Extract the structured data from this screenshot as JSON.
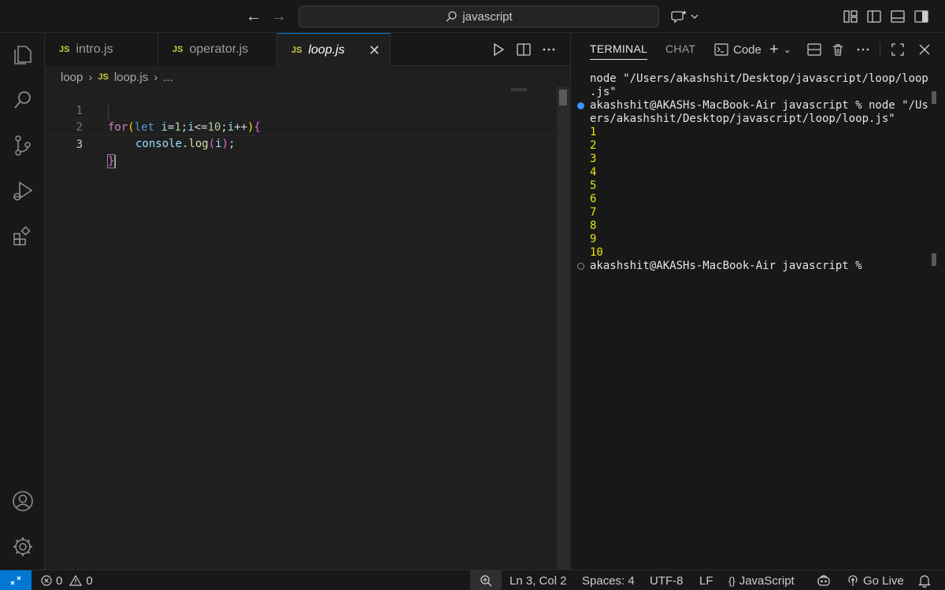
{
  "titlebar": {
    "search_text": "javascript"
  },
  "tabs": [
    {
      "label": "intro.js",
      "badge": "JS"
    },
    {
      "label": "operator.js",
      "badge": "JS"
    },
    {
      "label": "loop.js",
      "badge": "JS"
    }
  ],
  "breadcrumb": {
    "folder": "loop",
    "file": "loop.js",
    "more": "..."
  },
  "editor": {
    "line_numbers": [
      "1",
      "2",
      "3"
    ],
    "code": {
      "line1": {
        "kw_for": "for",
        "open_paren": "(",
        "kw_let": "let",
        "var1": "i",
        "eq": "=",
        "num1": "1",
        "semi1": ";",
        "var2": "i",
        "le": "<=",
        "num2": "10",
        "semi2": ";",
        "var3": "i",
        "inc": "++",
        "close_paren": ")",
        "open_brace": "{"
      },
      "line2": {
        "obj": "console",
        "dot": ".",
        "fn": "log",
        "open": "(",
        "arg": "i",
        "close": ")",
        "semi": ";"
      },
      "line3": {
        "close_brace": "}"
      }
    }
  },
  "panel": {
    "tabs": [
      "TERMINAL",
      "CHAT"
    ],
    "terminal_profile": "Code",
    "lines": [
      "node \"/Users/akashshit/Desktop/javascript/loop/loop",
      ".js\"",
      "akashshit@AKASHs-MacBook-Air javascript % node \"/Us",
      "ers/akashshit/Desktop/javascript/loop/loop.js\""
    ],
    "output": [
      "1",
      "2",
      "3",
      "4",
      "5",
      "6",
      "7",
      "8",
      "9",
      "10"
    ],
    "prompt": "akashshit@AKASHs-MacBook-Air javascript % "
  },
  "statusbar": {
    "errors": "0",
    "warnings": "0",
    "position": "Ln 3, Col 2",
    "spaces": "Spaces: 4",
    "encoding": "UTF-8",
    "eol": "LF",
    "language_braces": "{}",
    "language": "JavaScript",
    "golive": "Go Live"
  },
  "colors": {
    "accent": "#0078d4",
    "js_badge": "#cbcb41",
    "terminal_output": "#e5e510"
  }
}
